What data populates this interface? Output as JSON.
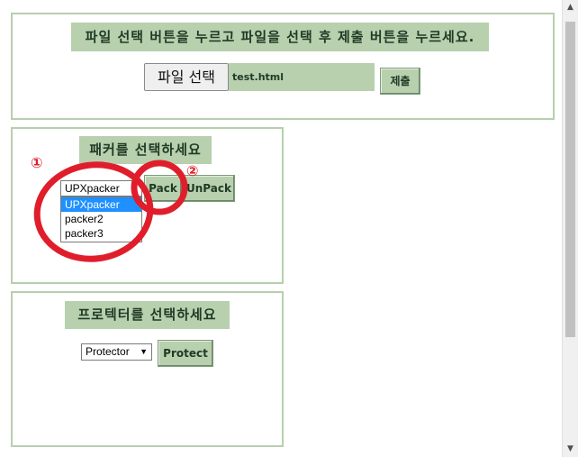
{
  "upload": {
    "instruction": "파일 선택 버튼을 누르고 파일을 선택 후 제출 버튼을 누르세요.",
    "file_button_label": "파일 선택",
    "file_name": "test.html",
    "submit_label": "제출"
  },
  "packer": {
    "heading": "패커를 선택하세요",
    "selected": "UPXpacker",
    "options": [
      "UPXpacker",
      "packer2",
      "packer3"
    ],
    "pack_label": "Pack",
    "unpack_label": "UnPack"
  },
  "protector": {
    "heading": "프로텍터를 선택하세요",
    "selected": "Protector",
    "protect_label": "Protect"
  },
  "annotations": {
    "marker1": "①",
    "marker2": "②",
    "color": "#e01e2b"
  },
  "colors": {
    "accent_green": "#b8d0ae",
    "border_green": "#b7cfae",
    "highlight_blue": "#1e90ff"
  }
}
